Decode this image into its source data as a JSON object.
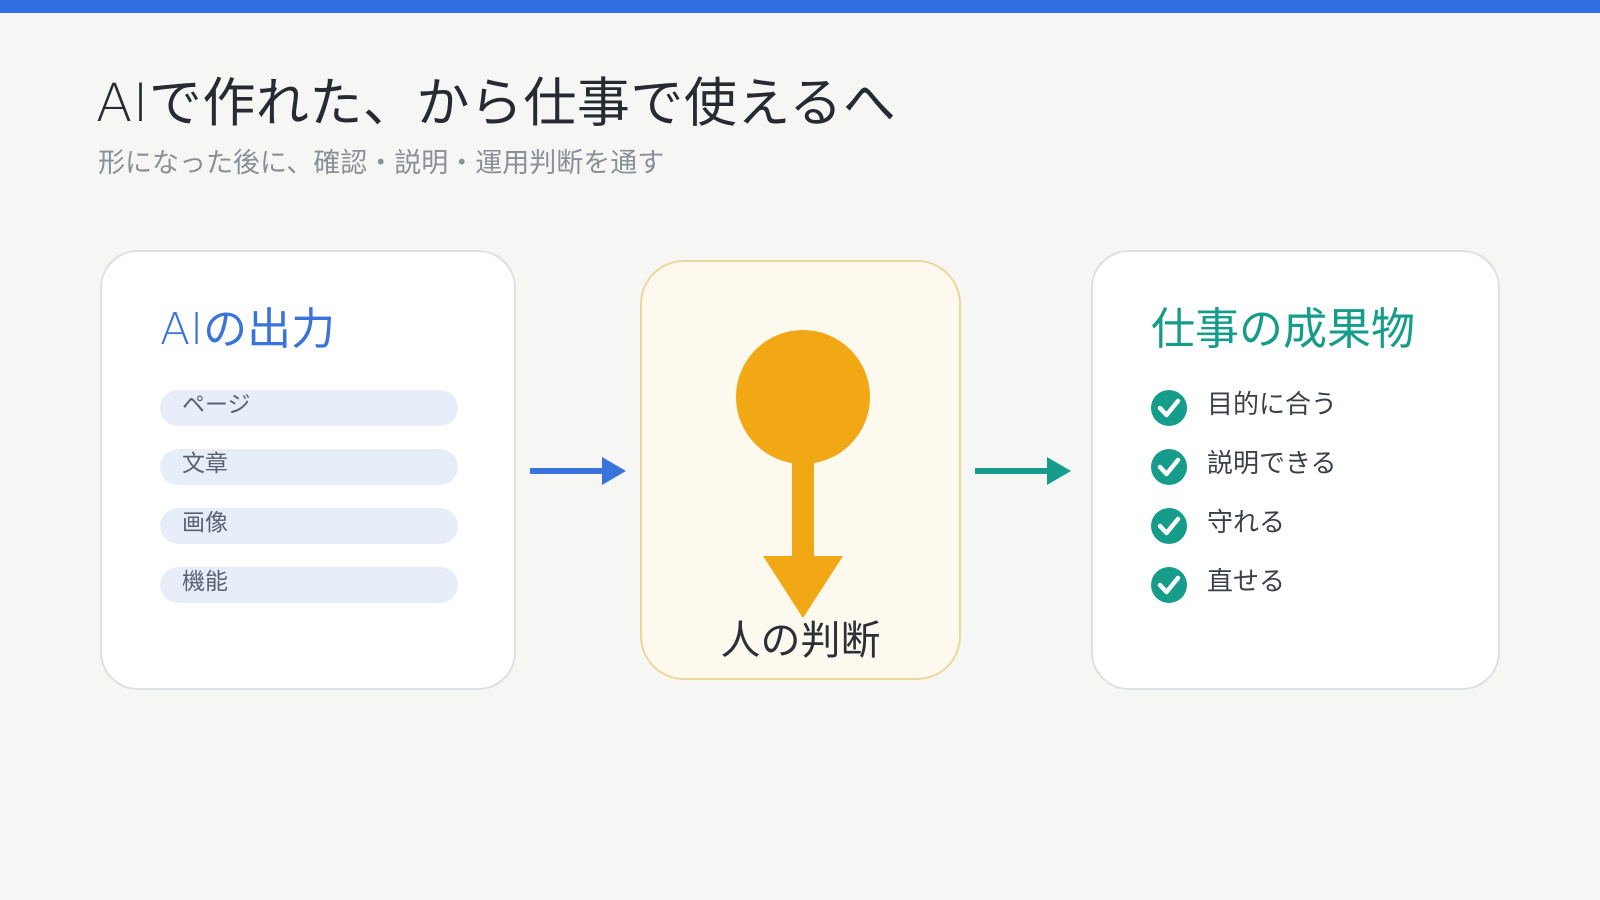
{
  "slide": {
    "title": "AIで作れた、から仕事で使えるへ",
    "subtitle": "形になった後に、確認・説明・運用判断を通す"
  },
  "input_card": {
    "title": "AIの出力",
    "items": [
      "ページ",
      "文章",
      "画像",
      "機能"
    ]
  },
  "judgement_card": {
    "label": "人の判断",
    "icon": "person-check-arrow-icon"
  },
  "output_card": {
    "title": "仕事の成果物",
    "items": [
      "目的に合う",
      "説明できる",
      "守れる",
      "直せる"
    ],
    "item_icon": "check-circle-icon"
  },
  "colors": {
    "top_bar": "#2f6fe0",
    "title_text": "#262b33",
    "subtitle_text": "#8a8f98",
    "accent_blue": "#3b73dc",
    "accent_teal": "#169c8a",
    "accent_orange": "#f2a714",
    "pill_bg": "#e8eef9"
  }
}
